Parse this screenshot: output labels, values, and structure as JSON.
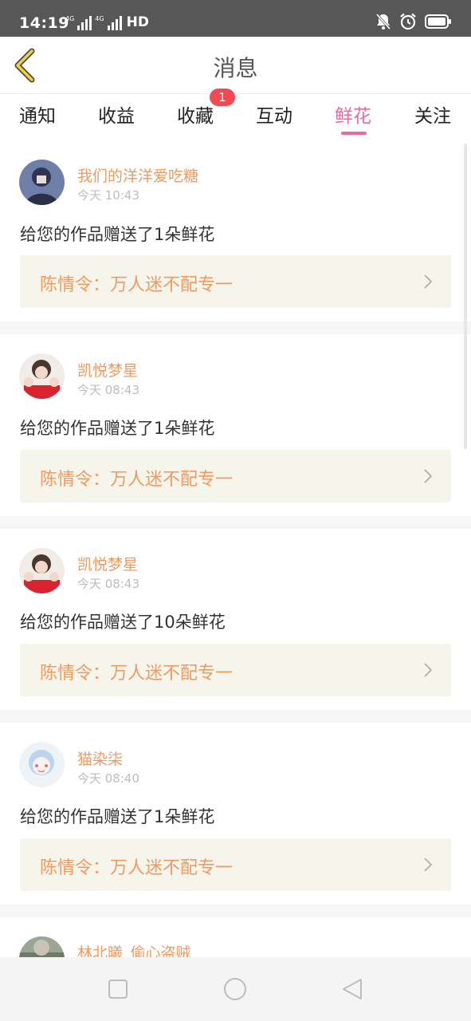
{
  "status_bar": {
    "time": "14:19",
    "network": "4G",
    "hd": "HD"
  },
  "header": {
    "title": "消息"
  },
  "tabs": [
    {
      "label": "通知"
    },
    {
      "label": "收益"
    },
    {
      "label": "收藏",
      "badge": "1"
    },
    {
      "label": "互动"
    },
    {
      "label": "鲜花",
      "active": true
    },
    {
      "label": "关注"
    }
  ],
  "messages": [
    {
      "user": "我们的洋洋爱吃糖",
      "time": "今天 10:43",
      "text": "给您的作品赠送了1朵鲜花",
      "work": "陈情令：万人迷不配专一"
    },
    {
      "user": "凯悦梦星",
      "time": "今天 08:43",
      "text": "给您的作品赠送了1朵鲜花",
      "work": "陈情令：万人迷不配专一"
    },
    {
      "user": "凯悦梦星",
      "time": "今天 08:43",
      "text": "给您的作品赠送了10朵鲜花",
      "work": "陈情令：万人迷不配专一"
    },
    {
      "user": "猫染柒",
      "time": "今天 08:40",
      "text": "给您的作品赠送了1朵鲜花",
      "work": "陈情令：万人迷不配专一"
    },
    {
      "user": "林北曦_偷心盗贼"
    }
  ],
  "colors": {
    "accent": "#e76aa0",
    "username": "#f09a60",
    "badge": "#f04a55",
    "link_bg": "#f5f5ec"
  }
}
